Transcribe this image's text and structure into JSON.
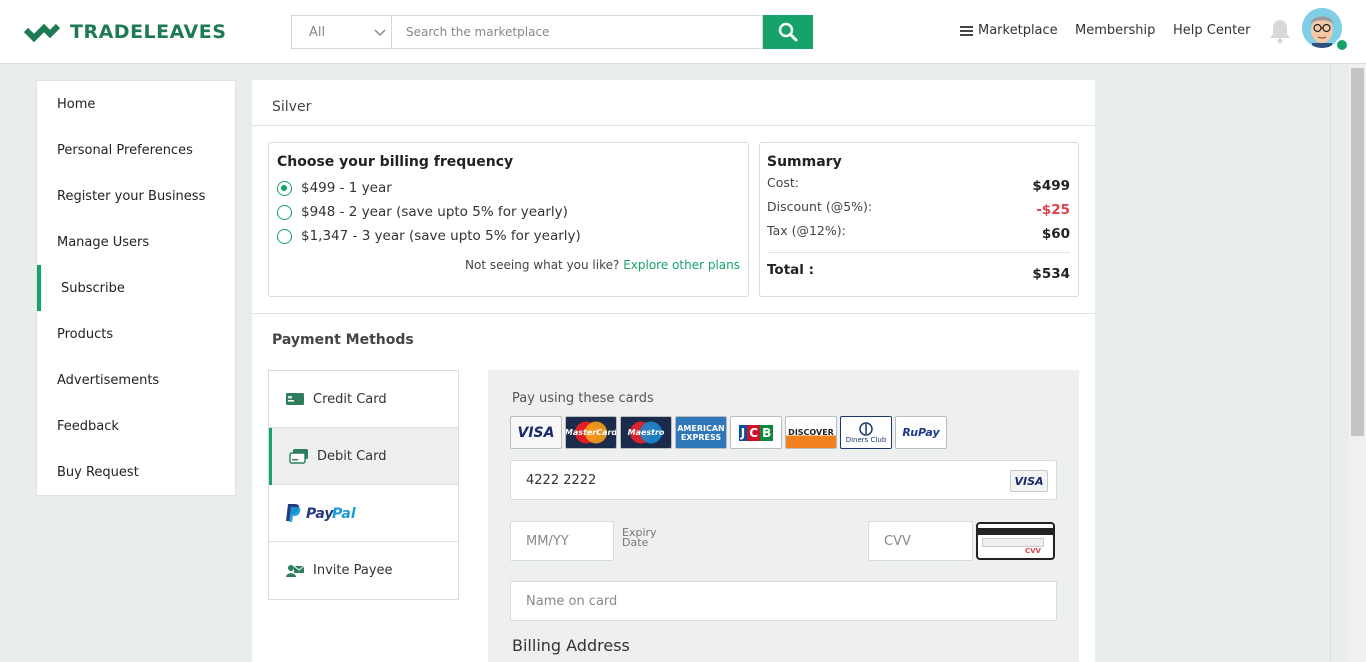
{
  "header": {
    "brand": "TRADELEAVES",
    "search_category": "All",
    "search_placeholder": "Search the marketplace",
    "nav": [
      "Marketplace",
      "Membership",
      "Help Center"
    ],
    "colors": {
      "brand_green": "#16a268",
      "brand_dark": "#1e7a52"
    }
  },
  "sidebar": {
    "items": [
      {
        "label": "Home"
      },
      {
        "label": "Personal Preferences"
      },
      {
        "label": "Register your Business"
      },
      {
        "label": "Manage Users"
      },
      {
        "label": "Subscribe",
        "active": true
      },
      {
        "label": "Products"
      },
      {
        "label": "Advertisements"
      },
      {
        "label": "Feedback"
      },
      {
        "label": "Buy Request"
      }
    ]
  },
  "plan": {
    "name": "Silver",
    "billing": {
      "title": "Choose your billing frequency",
      "options": [
        {
          "label": "$499 - 1 year",
          "checked": true
        },
        {
          "label": "$948 - 2 year  (save upto 5% for yearly)",
          "checked": false
        },
        {
          "label": "$1,347 - 3 year  (save upto 5% for yearly)",
          "checked": false
        }
      ],
      "explore_prefix": "Not seeing what you like?",
      "explore_link": "Explore other plans"
    },
    "summary": {
      "title": "Summary",
      "cost_label": "Cost:",
      "cost_value": "$499",
      "discount_label": "Discount (@5%):",
      "discount_value": "-$25",
      "tax_label": "Tax (@12%):",
      "tax_value": "$60",
      "total_label": "Total :",
      "total_value": "$534"
    }
  },
  "payment": {
    "title": "Payment Methods",
    "methods": [
      {
        "label": "Credit Card",
        "icon": "credit-card-icon"
      },
      {
        "label": "Debit Card",
        "icon": "debit-card-icon",
        "active": true
      },
      {
        "label": "PayPal",
        "icon": "paypal-logo"
      },
      {
        "label": "Invite Payee",
        "icon": "invite-payee-icon"
      }
    ],
    "pay_label": "Pay using these cards",
    "card_brands": [
      "VISA",
      "MasterCard",
      "Maestro",
      "AMERICAN EXPRESS",
      "JCB",
      "DISCOVER",
      "Diners Club",
      "RuPay"
    ],
    "card_number": "4222 2222",
    "detected_brand": "VISA",
    "expiry_placeholder": "MM/YY",
    "expiry_label": "Expiry Date",
    "cvv_placeholder": "CVV",
    "cvv_hint": "CVV",
    "name_placeholder": "Name on card",
    "billing_title": "Billing Address"
  }
}
